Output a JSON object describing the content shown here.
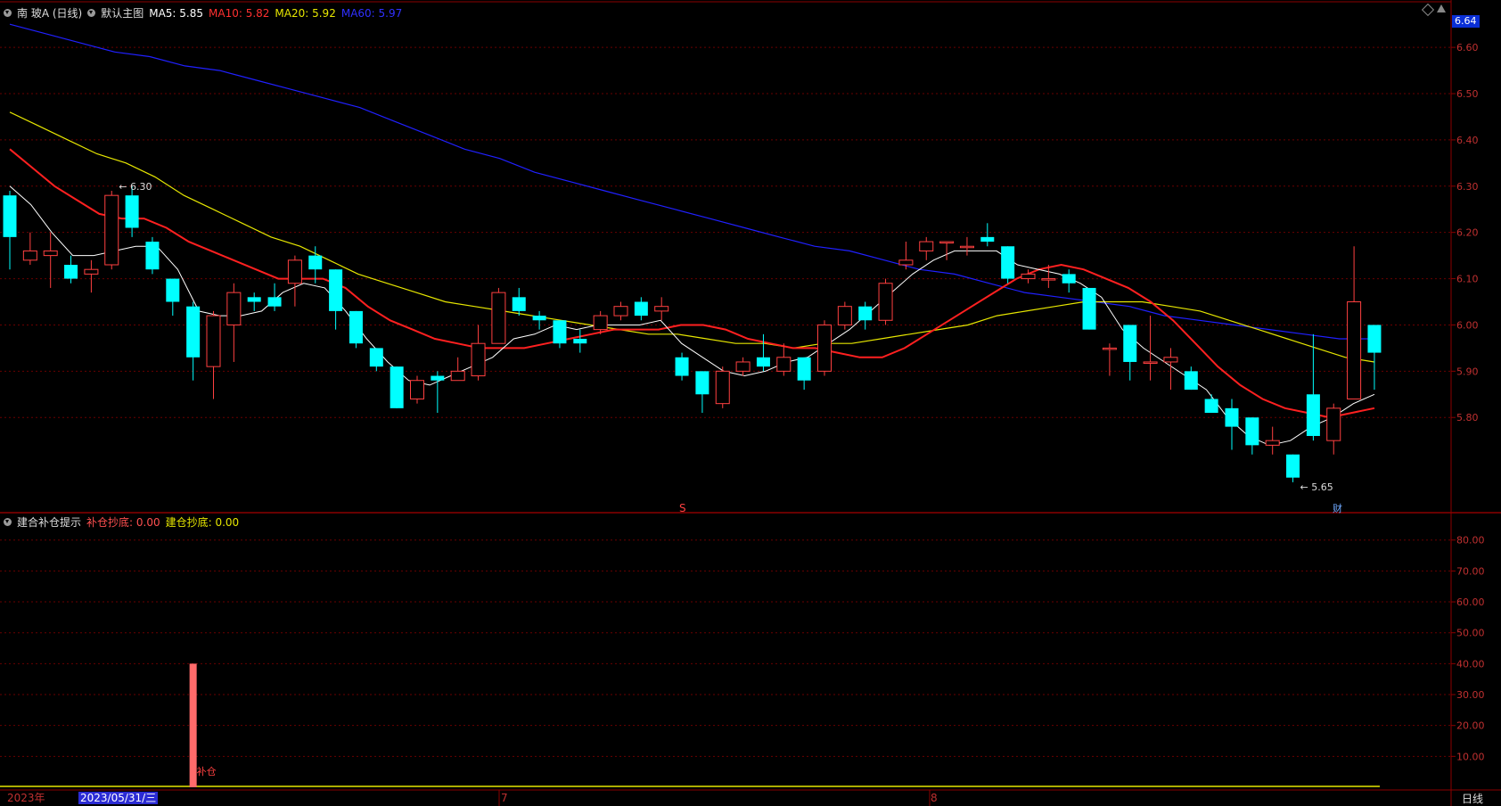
{
  "header": {
    "stock": "南 玻A (日线)",
    "main_label": "默认主图",
    "ma5": "MA5: 5.85",
    "ma10": "MA10: 5.82",
    "ma20": "MA20: 5.92",
    "ma60": "MA60: 5.97"
  },
  "indicator_header": {
    "name": "建合补仓提示",
    "buy1": "补仓抄底: 0.00",
    "buy2": "建仓抄底: 0.00"
  },
  "bottom": {
    "year": "2023年",
    "date": "2023/05/31/三",
    "month7": "7",
    "month8": "8",
    "period": "日线"
  },
  "price_tag": "6.64",
  "colors": {
    "up": "#ff4040",
    "down": "#00ffff",
    "ma5": "#ffffff",
    "ma10": "#ff2020",
    "ma20": "#e6e600",
    "ma60": "#2020ff",
    "axis": "#8b0000",
    "grid": "#6a0000"
  },
  "chart_data": [
    {
      "type": "candlestick",
      "price_axis_ticks": [
        "6.60",
        "6.50",
        "6.40",
        "6.30",
        "6.20",
        "6.10",
        "6.00",
        "5.90",
        "5.80"
      ],
      "ylim": [
        5.6,
        6.66
      ],
      "annotations": {
        "high": "6.30",
        "low": "5.65",
        "dividend_mark": "S",
        "report_mark": "财"
      },
      "candles": [
        [
          6.28,
          6.19,
          6.29,
          6.12
        ],
        [
          6.14,
          6.16,
          6.2,
          6.13
        ],
        [
          6.15,
          6.16,
          6.2,
          6.08
        ],
        [
          6.13,
          6.1,
          6.15,
          6.09
        ],
        [
          6.11,
          6.12,
          6.14,
          6.07
        ],
        [
          6.13,
          6.28,
          6.29,
          6.12
        ],
        [
          6.28,
          6.21,
          6.3,
          6.19
        ],
        [
          6.18,
          6.12,
          6.19,
          6.11
        ],
        [
          6.1,
          6.05,
          6.1,
          6.02
        ],
        [
          6.04,
          5.93,
          6.05,
          5.88
        ],
        [
          5.91,
          6.02,
          6.03,
          5.84
        ],
        [
          6.0,
          6.07,
          6.09,
          5.92
        ],
        [
          6.06,
          6.05,
          6.07,
          6.03
        ],
        [
          6.06,
          6.04,
          6.09,
          6.03
        ],
        [
          6.09,
          6.14,
          6.15,
          6.04
        ],
        [
          6.15,
          6.12,
          6.17,
          6.09
        ],
        [
          6.12,
          6.03,
          6.12,
          5.99
        ],
        [
          6.03,
          5.96,
          6.03,
          5.95
        ],
        [
          5.95,
          5.91,
          5.95,
          5.9
        ],
        [
          5.91,
          5.82,
          5.91,
          5.82
        ],
        [
          5.84,
          5.88,
          5.89,
          5.83
        ],
        [
          5.89,
          5.88,
          5.9,
          5.81
        ],
        [
          5.88,
          5.9,
          5.93,
          5.88
        ],
        [
          5.89,
          5.96,
          6.0,
          5.88
        ],
        [
          5.96,
          6.07,
          6.08,
          5.96
        ],
        [
          6.06,
          6.03,
          6.08,
          6.02
        ],
        [
          6.02,
          6.01,
          6.03,
          5.99
        ],
        [
          6.01,
          5.96,
          6.01,
          5.95
        ],
        [
          5.97,
          5.96,
          5.99,
          5.94
        ],
        [
          5.99,
          6.02,
          6.03,
          5.98
        ],
        [
          6.02,
          6.04,
          6.05,
          6.01
        ],
        [
          6.05,
          6.02,
          6.06,
          6.01
        ],
        [
          6.03,
          6.04,
          6.06,
          6.01
        ],
        [
          5.93,
          5.89,
          5.94,
          5.88
        ],
        [
          5.9,
          5.85,
          5.9,
          5.81
        ],
        [
          5.83,
          5.9,
          5.91,
          5.82
        ],
        [
          5.9,
          5.92,
          5.93,
          5.89
        ],
        [
          5.93,
          5.91,
          5.98,
          5.9
        ],
        [
          5.9,
          5.93,
          5.96,
          5.89
        ],
        [
          5.93,
          5.88,
          5.93,
          5.86
        ],
        [
          5.9,
          6.0,
          6.01,
          5.89
        ],
        [
          6.0,
          6.04,
          6.05,
          5.99
        ],
        [
          6.04,
          6.01,
          6.05,
          5.99
        ],
        [
          6.01,
          6.09,
          6.1,
          6.0
        ],
        [
          6.13,
          6.14,
          6.18,
          6.12
        ],
        [
          6.16,
          6.18,
          6.19,
          6.14
        ],
        [
          6.18,
          6.18,
          6.18,
          6.14
        ],
        [
          6.17,
          6.17,
          6.19,
          6.15
        ],
        [
          6.19,
          6.18,
          6.22,
          6.17
        ],
        [
          6.17,
          6.1,
          6.17,
          6.09
        ],
        [
          6.1,
          6.11,
          6.12,
          6.09
        ],
        [
          6.1,
          6.1,
          6.13,
          6.08
        ],
        [
          6.11,
          6.09,
          6.12,
          6.07
        ],
        [
          6.08,
          5.99,
          6.08,
          5.99
        ],
        [
          5.95,
          5.95,
          5.96,
          5.89
        ],
        [
          6.0,
          5.92,
          6.0,
          5.88
        ],
        [
          5.92,
          5.92,
          6.02,
          5.88
        ],
        [
          5.92,
          5.93,
          5.95,
          5.86
        ],
        [
          5.9,
          5.86,
          5.91,
          5.86
        ],
        [
          5.84,
          5.81,
          5.85,
          5.81
        ],
        [
          5.82,
          5.78,
          5.84,
          5.73
        ],
        [
          5.8,
          5.74,
          5.8,
          5.72
        ],
        [
          5.74,
          5.75,
          5.78,
          5.72
        ],
        [
          5.72,
          5.67,
          5.72,
          5.66
        ],
        [
          5.85,
          5.76,
          5.98,
          5.75
        ],
        [
          5.75,
          5.82,
          5.83,
          5.72
        ],
        [
          5.84,
          6.05,
          6.17,
          5.84
        ],
        [
          6.0,
          5.94,
          6.0,
          5.86
        ]
      ],
      "ma": {
        "MA5": [
          6.3,
          6.26,
          6.2,
          6.15,
          6.15,
          6.16,
          6.17,
          6.17,
          6.12,
          6.03,
          6.02,
          6.02,
          6.03,
          6.07,
          6.09,
          6.08,
          6.03,
          5.97,
          5.92,
          5.88,
          5.87,
          5.89,
          5.91,
          5.93,
          5.97,
          5.98,
          6.0,
          5.99,
          6.0,
          6.0,
          6.0,
          6.01,
          5.96,
          5.93,
          5.9,
          5.89,
          5.9,
          5.92,
          5.93,
          5.96,
          5.99,
          6.03,
          6.07,
          6.11,
          6.14,
          6.16,
          6.16,
          6.16,
          6.13,
          6.12,
          6.11,
          6.09,
          6.06,
          5.99,
          5.95,
          5.92,
          5.89,
          5.86,
          5.8,
          5.76,
          5.74,
          5.75,
          5.78,
          5.8,
          5.83,
          5.85
        ],
        "MA10": [
          6.38,
          6.34,
          6.3,
          6.27,
          6.24,
          6.23,
          6.23,
          6.21,
          6.18,
          6.16,
          6.14,
          6.12,
          6.1,
          6.1,
          6.1,
          6.08,
          6.04,
          6.01,
          5.99,
          5.97,
          5.96,
          5.95,
          5.95,
          5.95,
          5.96,
          5.97,
          5.98,
          5.99,
          5.99,
          5.99,
          6.0,
          6.0,
          5.99,
          5.97,
          5.96,
          5.95,
          5.95,
          5.94,
          5.93,
          5.93,
          5.95,
          5.98,
          6.01,
          6.04,
          6.07,
          6.1,
          6.12,
          6.13,
          6.12,
          6.1,
          6.08,
          6.05,
          6.01,
          5.96,
          5.91,
          5.87,
          5.84,
          5.82,
          5.81,
          5.8,
          5.81,
          5.82
        ],
        "MA20": [
          6.46,
          6.43,
          6.4,
          6.37,
          6.35,
          6.32,
          6.28,
          6.25,
          6.22,
          6.19,
          6.17,
          6.14,
          6.11,
          6.09,
          6.07,
          6.05,
          6.04,
          6.03,
          6.02,
          6.01,
          6.0,
          5.99,
          5.98,
          5.98,
          5.97,
          5.96,
          5.96,
          5.95,
          5.96,
          5.96,
          5.97,
          5.98,
          5.99,
          6.0,
          6.02,
          6.03,
          6.04,
          6.05,
          6.05,
          6.05,
          6.04,
          6.03,
          6.01,
          5.99,
          5.97,
          5.95,
          5.93,
          5.92
        ],
        "MA60": [
          6.65,
          6.63,
          6.61,
          6.59,
          6.58,
          6.56,
          6.55,
          6.53,
          6.51,
          6.49,
          6.47,
          6.44,
          6.41,
          6.38,
          6.36,
          6.33,
          6.31,
          6.29,
          6.27,
          6.25,
          6.23,
          6.21,
          6.19,
          6.17,
          6.16,
          6.14,
          6.12,
          6.11,
          6.09,
          6.07,
          6.06,
          6.05,
          6.04,
          6.02,
          6.01,
          6.0,
          5.99,
          5.98,
          5.97,
          5.97
        ]
      }
    },
    {
      "type": "bar",
      "title": "建合补仓提示",
      "axis_ticks": [
        "80.00",
        "70.00",
        "60.00",
        "50.00",
        "40.00",
        "30.00",
        "20.00",
        "10.00"
      ],
      "ylim": [
        0,
        88
      ],
      "bar": {
        "index": 9,
        "value": 40,
        "label": "补仓"
      },
      "baseline_value": 0
    }
  ]
}
